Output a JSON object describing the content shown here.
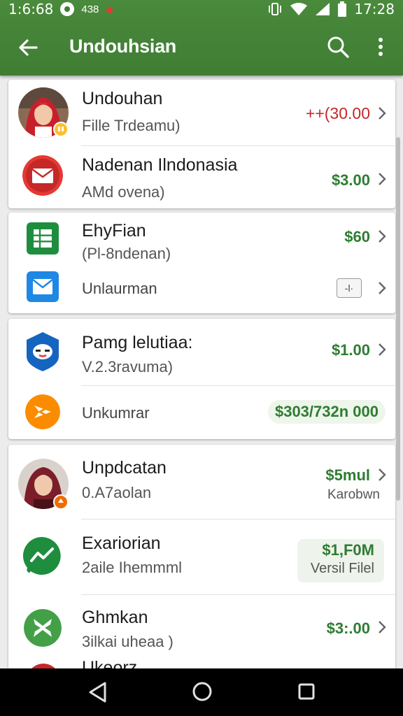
{
  "status_bar": {
    "clock_left": "1:6:68",
    "small_text": "438",
    "time_right": "17:28"
  },
  "app_bar": {
    "title": "Undouhsian"
  },
  "colors": {
    "app_bar": "#3f7d33",
    "amount_green": "#2e7d32",
    "amount_red": "#c62828"
  },
  "cards": [
    {
      "rows": [
        {
          "title": "Undouhan",
          "subtitle": "Fille Trdeamu)",
          "amount": "++(30.00",
          "icon": "profile-avatar-red-hijab"
        },
        {
          "title": "Nadenan Ilndonasia",
          "subtitle": "AMd ovena)",
          "amount": "$3.00",
          "icon": "mail-icon-red"
        }
      ]
    },
    {
      "rows": [
        {
          "title": "EhyFian",
          "subtitle": "(Pl-8ndenan)",
          "amount": "$60",
          "icon": "sheets-icon"
        },
        {
          "label": "Unlaurman",
          "button_label": "-l·",
          "icon": "mail-icon-blue"
        }
      ]
    },
    {
      "rows": [
        {
          "title": "Pamg lelutiaa:",
          "subtitle": "V.2.3ravuma)",
          "amount": "$1.00",
          "icon": "shield-face-icon"
        },
        {
          "label": "Unkumrar",
          "amount": "$303/732n 000",
          "icon": "share-icon-orange"
        }
      ]
    },
    {
      "rows": [
        {
          "title": "Unpdcatan",
          "subtitle": "0.A7aolan",
          "amount": "$5mul",
          "amount_sub": "Karobwn",
          "icon": "profile-avatar-maroon-hijab"
        },
        {
          "title": "Exariorian",
          "subtitle": "2aile Ihemmml",
          "amount": "$1,F0M",
          "amount_sub": "Versil Filel",
          "icon": "chart-line-icon-green"
        },
        {
          "title": "Ghmkan",
          "subtitle": "3ilkai uheaa )",
          "amount": "$3:.00",
          "icon": "fan-icon-green"
        },
        {
          "title": "Ukeorz",
          "icon": "red-circle-icon"
        }
      ]
    }
  ]
}
